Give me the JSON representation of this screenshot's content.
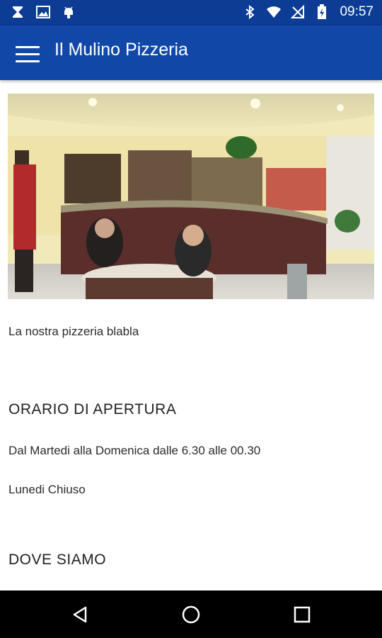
{
  "status_bar": {
    "time": "09:57",
    "left_icons": [
      "hourglass-icon",
      "image-icon",
      "android-debug-icon"
    ],
    "right_icons": [
      "bluetooth-icon",
      "wifi-icon",
      "no-sim-icon",
      "battery-charging-icon"
    ]
  },
  "app_bar": {
    "title": "Il Mulino Pizzeria",
    "menu_icon": "hamburger-menu-icon",
    "color": "#1148a8"
  },
  "content": {
    "description": "La nostra pizzeria blabla",
    "opening_hours": {
      "heading": "ORARIO DI APERTURA",
      "line1": "Dal Martedi alla Domenica dalle 6.30 alle 00.30",
      "line2": "Lunedi Chiuso"
    },
    "location": {
      "heading": "DOVE SIAMO"
    }
  },
  "nav_bar": {
    "buttons": [
      "back-icon",
      "home-icon",
      "recents-icon"
    ]
  }
}
